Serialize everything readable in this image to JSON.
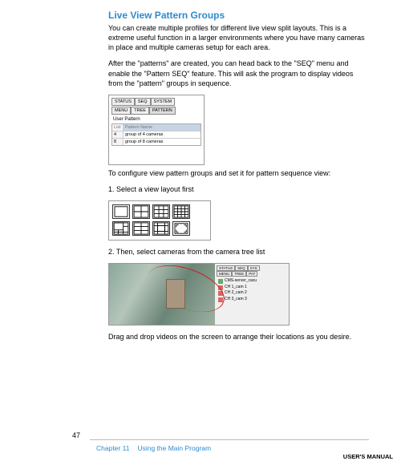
{
  "heading": "Live View Pattern Groups",
  "p1": "You can create multiple profiles for different live view split layouts. This is a extreme useful function in a larger environments where you have many cameras in place and multiple cameras setup for each area.",
  "p2": "After the \"patterns\" are created, you can head back to the \"SEQ\" menu and enable the \"Pattern SEQ\" feature. This will ask the program to display videos from the \"pattern\" groups in sequence.",
  "p3": "To configure view pattern groups and set it for pattern sequence view:",
  "step1": "1. Select a view layout first",
  "step2": "2. Then, select cameras from the camera tree list",
  "p4": "Drag and drop videos on the screen to arrange their locations as you desire.",
  "fig1": {
    "tabs_row1": [
      "STATUS",
      "SEQ",
      "SYSTEM"
    ],
    "tabs_row2": [
      "MENU",
      "TREE",
      "PATTERN"
    ],
    "label": "User Pattern",
    "header": [
      "List",
      "Pattern Name"
    ],
    "rows": [
      [
        "4",
        "group of 4 cameras"
      ],
      [
        "8",
        "group of 8 cameras"
      ]
    ]
  },
  "fig3": {
    "tabs": [
      "STATUS",
      "SEQ",
      "SYS"
    ],
    "tabs2": [
      "MENU",
      "TREE",
      "PAT"
    ],
    "items": [
      "CMS-server_cacu",
      "CH 1_cam 1",
      "CH 2_cam 2",
      "CH 3_cam 3"
    ]
  },
  "page_num": "47",
  "chapter_num": "Chapter 11",
  "chapter_title": "Using the Main Program",
  "manual": "USER'S MANUAL"
}
